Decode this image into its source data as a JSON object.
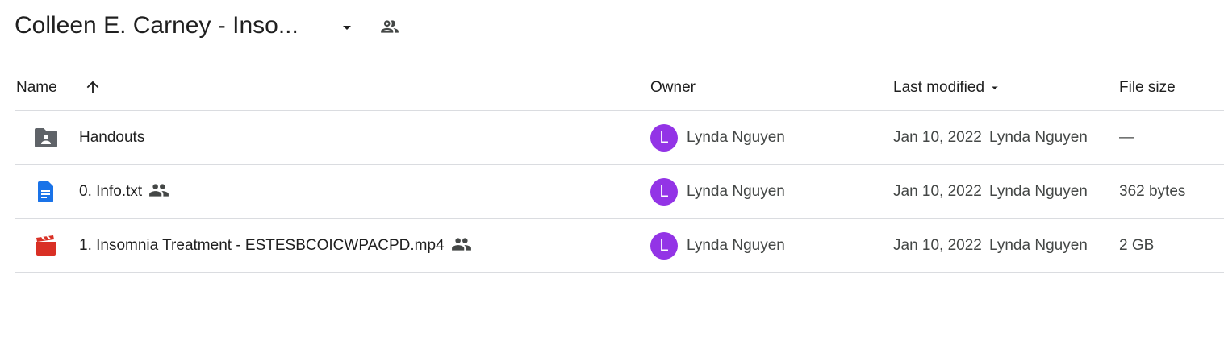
{
  "header": {
    "title": "Colleen E. Carney - Inso...",
    "caret_icon": "arrow-drop-down-icon",
    "shared_icon": "people-icon"
  },
  "columns": {
    "name": "Name",
    "owner": "Owner",
    "last_modified": "Last modified",
    "file_size": "File size"
  },
  "sort": {
    "column": "Name",
    "direction": "ascending",
    "icon": "arrow-up-icon"
  },
  "colors": {
    "avatar": "#9334e6",
    "folder": "#5f6368",
    "doc": "#1a73e8",
    "video": "#d93025"
  },
  "rows": [
    {
      "icon": "shared-folder-icon",
      "name": "Handouts",
      "shared": false,
      "owner_initial": "L",
      "owner": "Lynda Nguyen",
      "modified_date": "Jan 10, 2022",
      "modified_by": "Lynda Nguyen",
      "size": "—"
    },
    {
      "icon": "document-icon",
      "name": "0. Info.txt",
      "shared": true,
      "owner_initial": "L",
      "owner": "Lynda Nguyen",
      "modified_date": "Jan 10, 2022",
      "modified_by": "Lynda Nguyen",
      "size": "362 bytes"
    },
    {
      "icon": "video-icon",
      "name": "1. Insomnia Treatment - ESTESBCOICWPACPD.mp4",
      "shared": true,
      "owner_initial": "L",
      "owner": "Lynda Nguyen",
      "modified_date": "Jan 10, 2022",
      "modified_by": "Lynda Nguyen",
      "size": "2 GB"
    }
  ]
}
